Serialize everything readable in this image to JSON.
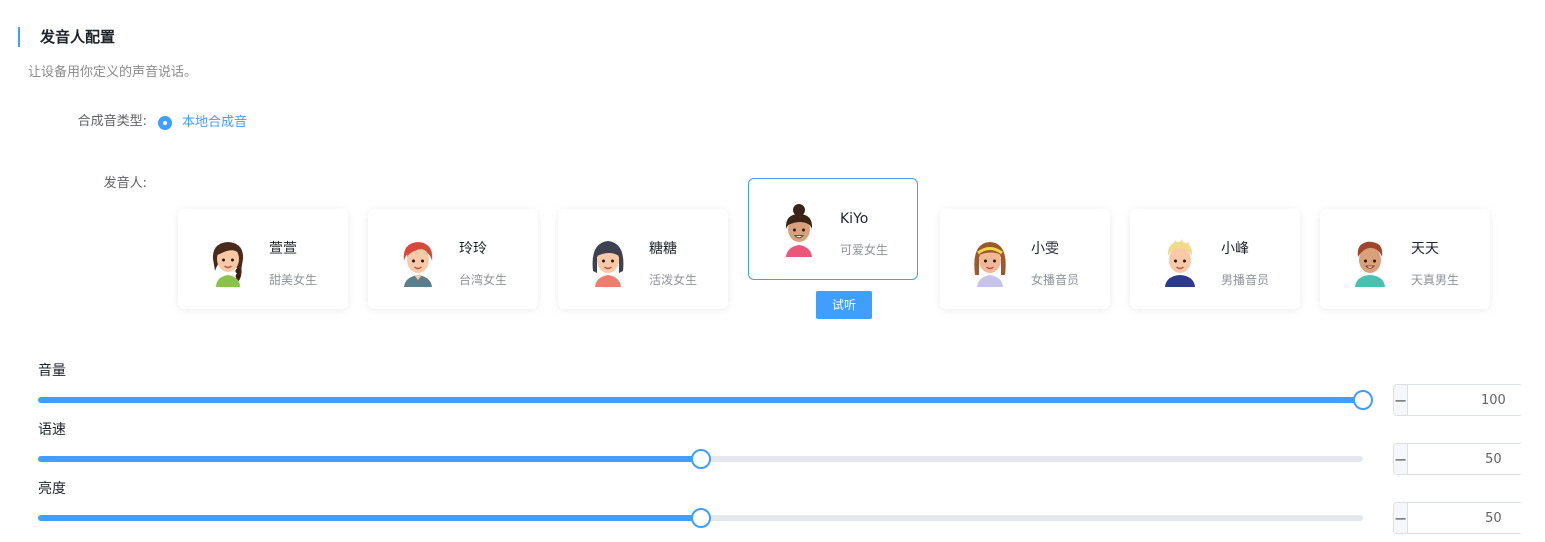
{
  "section": {
    "title": "发音人配置",
    "description": "让设备用你定义的声音说话。"
  },
  "synthesis": {
    "label": "合成音类型:",
    "option": "本地合成音"
  },
  "speaker": {
    "label": "发音人:",
    "listen_button": "试听",
    "selected_index": 3,
    "cards": [
      {
        "name": "萱萱",
        "desc": "甜美女生",
        "icon": "girl-braid-avatar-icon"
      },
      {
        "name": "玲玲",
        "desc": "台湾女生",
        "icon": "girl-red-hair-avatar-icon"
      },
      {
        "name": "糖糖",
        "desc": "活泼女生",
        "icon": "girl-dark-hair-avatar-icon"
      },
      {
        "name": "KiYo",
        "desc": "可爱女生",
        "icon": "girl-bun-avatar-icon"
      },
      {
        "name": "小雯",
        "desc": "女播音员",
        "icon": "girl-headband-avatar-icon"
      },
      {
        "name": "小峰",
        "desc": "男播音员",
        "icon": "boy-blond-avatar-icon"
      },
      {
        "name": "天天",
        "desc": "天真男生",
        "icon": "boy-brown-hair-avatar-icon"
      }
    ]
  },
  "sliders": [
    {
      "label": "音量",
      "value": "100",
      "min": 0,
      "max": 100,
      "fraction": 1.0
    },
    {
      "label": "语速",
      "value": "50",
      "min": 0,
      "max": 100,
      "fraction": 0.5
    },
    {
      "label": "亮度",
      "value": "50",
      "min": 0,
      "max": 100,
      "fraction": 0.5
    }
  ],
  "stepper": {
    "minus": "−",
    "plus": "+"
  },
  "colors": {
    "accent": "#409eff",
    "track": "#e4e7ed"
  }
}
